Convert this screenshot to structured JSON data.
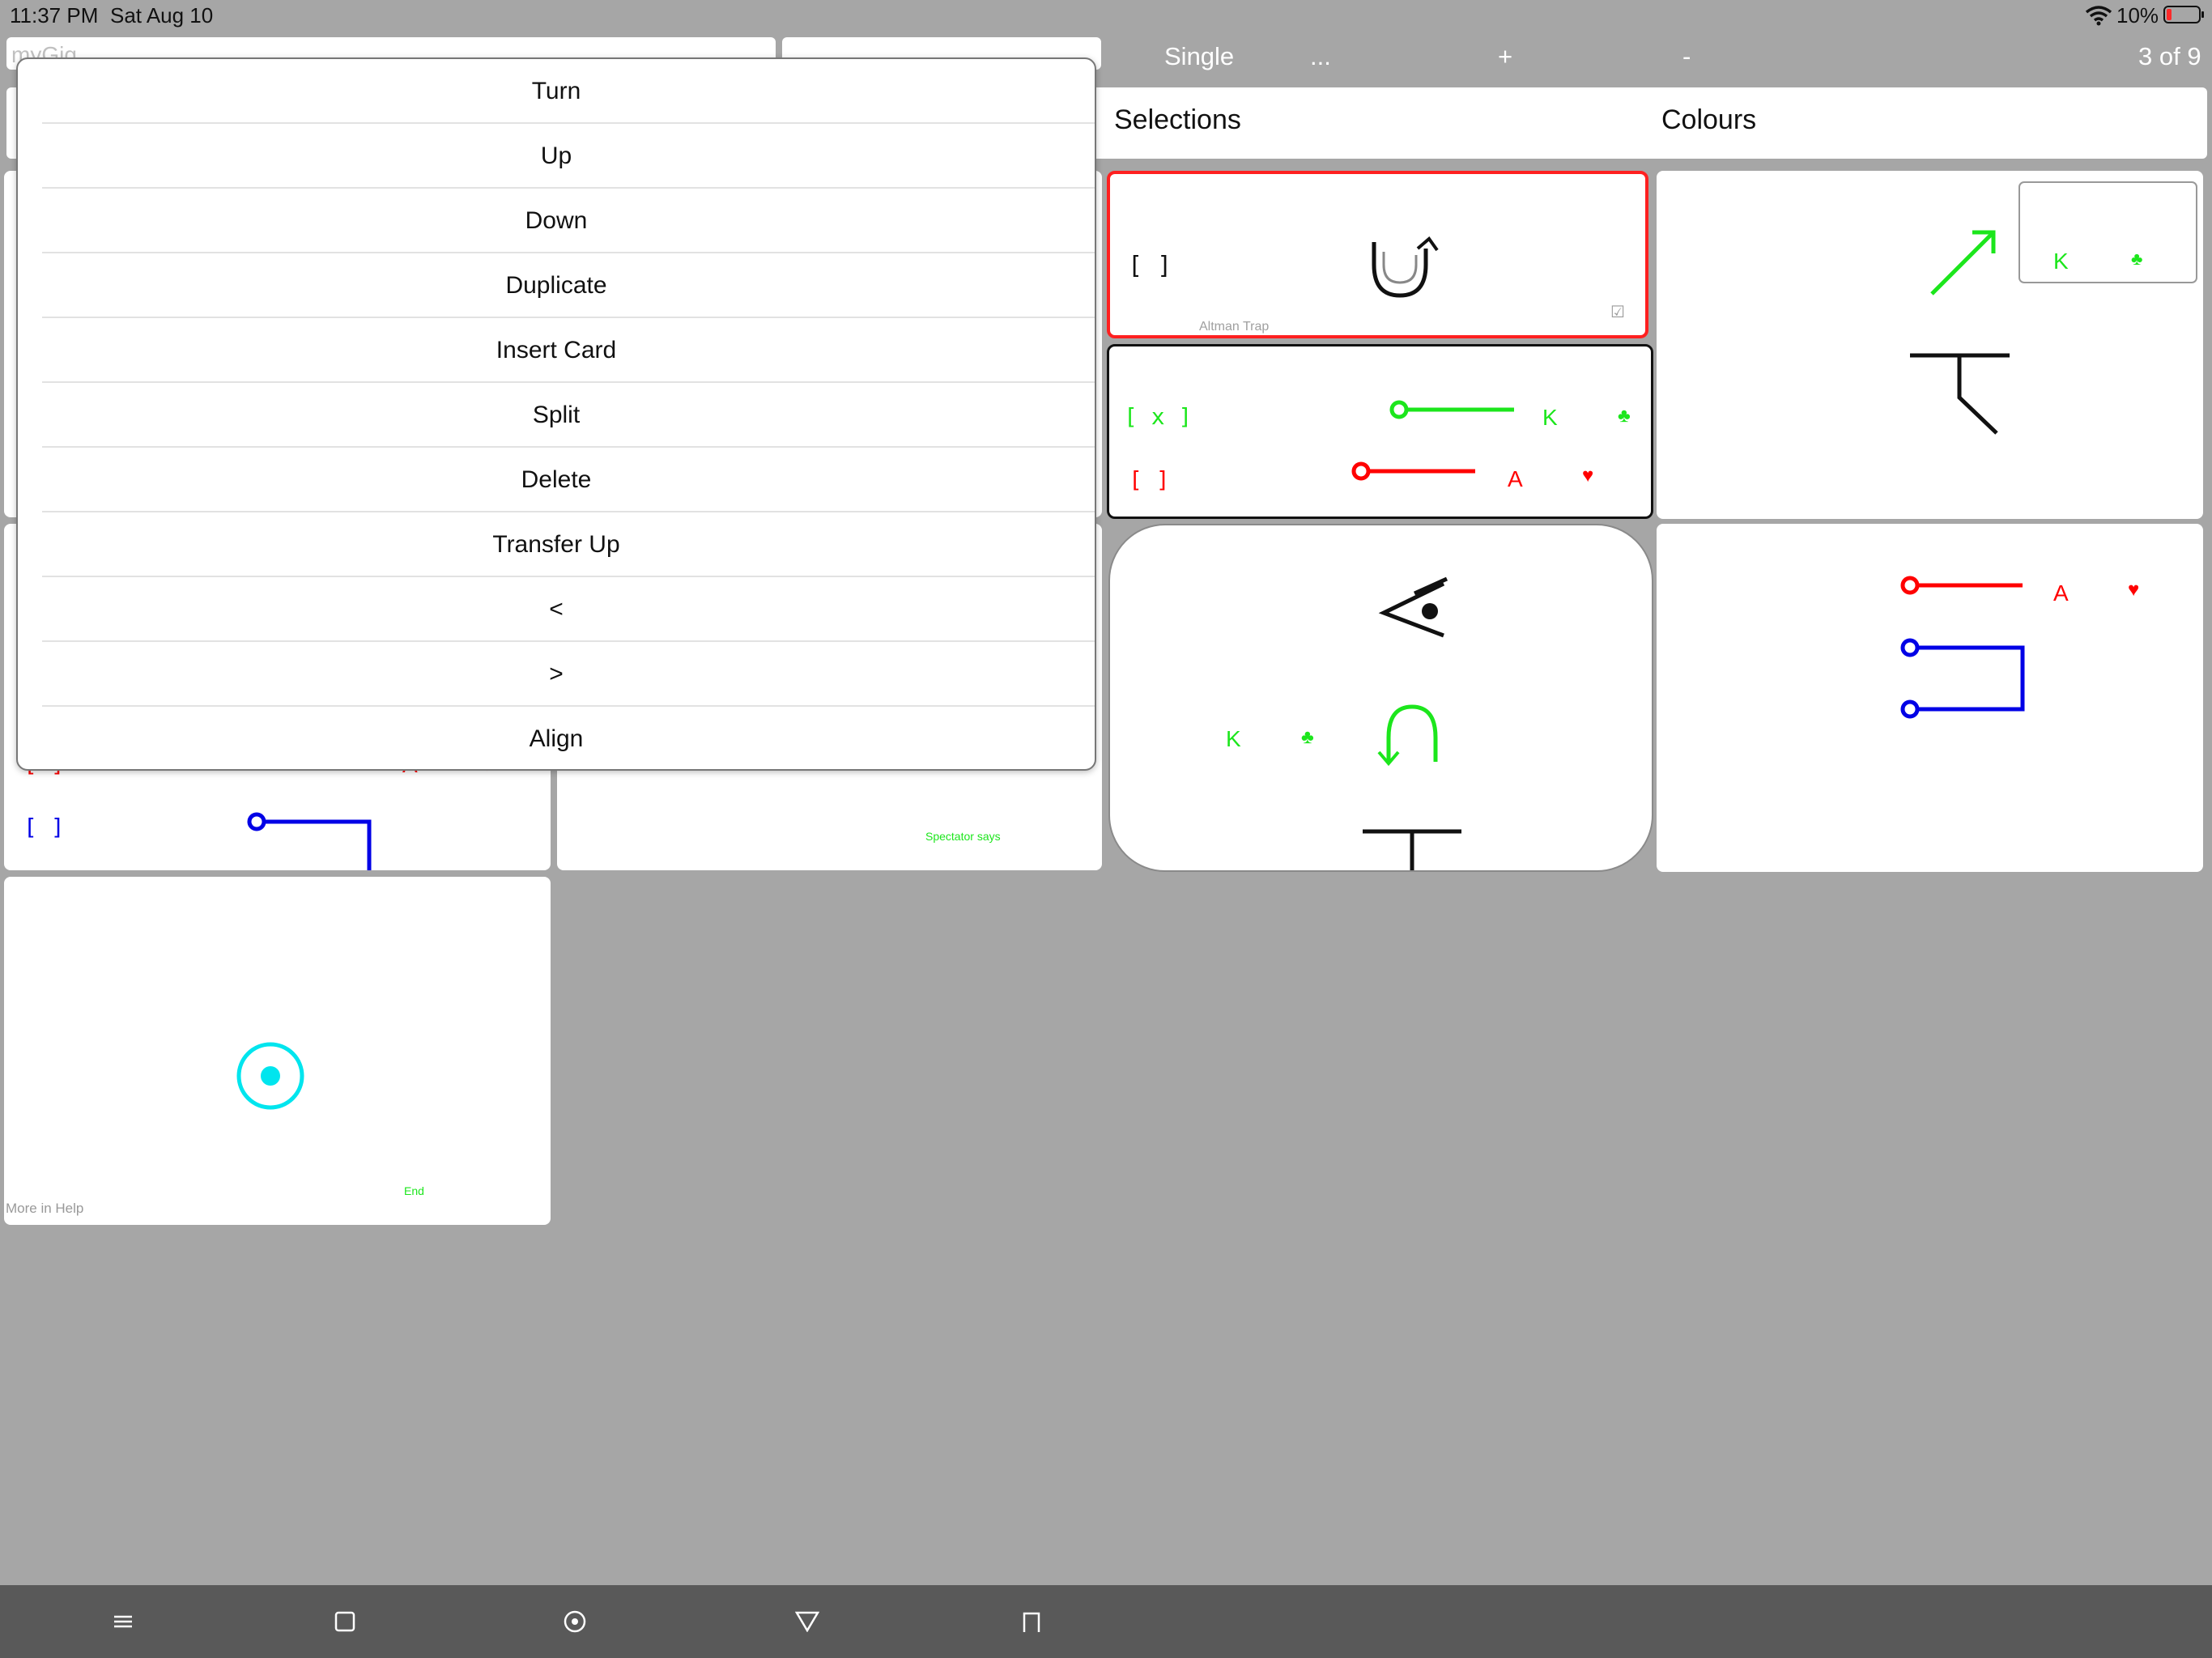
{
  "status_bar": {
    "time": "11:37 PM",
    "date": "Sat Aug 10",
    "battery": "10%"
  },
  "toolbar": {
    "name_field_value": "myGig",
    "mode_label": "Single",
    "more_label": "...",
    "plus_label": "+",
    "minus_label": "-",
    "page_counter": "3 of 9"
  },
  "headers": {
    "selections": "Selections",
    "colours": "Colours"
  },
  "context_menu": {
    "items": [
      "Turn",
      "Up",
      "Down",
      "Duplicate",
      "Insert Card",
      "Split",
      "Delete",
      "Transfer Up",
      "<",
      ">",
      "Align"
    ]
  },
  "cards": {
    "altman": {
      "bracket": "[  ]",
      "caption": "Altman Trap"
    },
    "selections": {
      "green_bracket": "[ x ]",
      "green_rank": "K",
      "green_suit": "♣",
      "red_bracket": "[  ]",
      "red_rank": "A",
      "red_suit": "♥"
    },
    "eye_card": {
      "rank": "K",
      "suit": "♣"
    },
    "colours_top": {
      "rank": "K",
      "suit": "♣"
    },
    "colours_bottom": {
      "rank": "A",
      "suit": "♥"
    },
    "left_partial": {
      "red_bracket": "[  ]",
      "red_rank": "A",
      "red_suit": "♥",
      "blue_bracket": "[  ]"
    },
    "middle_partial": {
      "caption": "Spectator says"
    },
    "end_card": {
      "footer": "More in Help",
      "end_label": "End"
    }
  },
  "bottom_bar": {
    "icons": [
      "menu-icon",
      "square-icon",
      "target-icon",
      "triangle-icon",
      "bracket-icon"
    ]
  },
  "colors": {
    "red": "#ff0000",
    "green": "#1ce61c",
    "blue": "#0000e6",
    "cyan": "#00e5ee",
    "gray_bg": "#a6a6a6"
  }
}
